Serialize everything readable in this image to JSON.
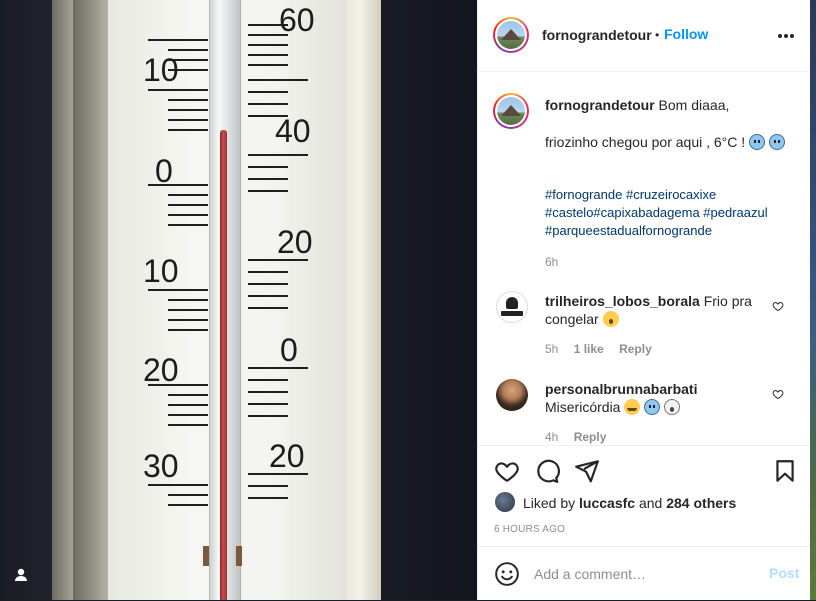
{
  "photo": {
    "alt_subject": "thermometer",
    "scale_left": [
      "10",
      "0",
      "10",
      "20",
      "30"
    ],
    "scale_right": [
      "60",
      "40",
      "20",
      "0",
      "20"
    ]
  },
  "header": {
    "username": "fornograndetour",
    "separator": "•",
    "follow_label": "Follow"
  },
  "caption": {
    "username": "fornograndetour",
    "line1": "Bom diaaa,",
    "line2": "friozinho chegou por aqui , 6°C !",
    "hashtags": [
      "#fornogrande",
      "#cruzeirocaxixe",
      "#castelo",
      "#capixabadagema",
      "#pedraazul",
      "#parqueestadualfornogrande"
    ],
    "time": "6h"
  },
  "comments": [
    {
      "username": "trilheiros_lobos_borala",
      "text": "Frio pra congelar",
      "time": "5h",
      "likes": "1 like",
      "reply": "Reply"
    },
    {
      "username": "personalbrunnabarbati",
      "text": "Misericórdia",
      "time": "4h",
      "reply": "Reply"
    }
  ],
  "likes": {
    "prefix": "Liked by",
    "user": "luccasfc",
    "and": "and",
    "others": "284 others"
  },
  "time_ago": "6 HOURS AGO",
  "add_comment": {
    "placeholder": "Add a comment…",
    "post_label": "Post"
  },
  "colors": {
    "accent": "#0095f6",
    "hashtag": "#00376b",
    "muted": "#8e8e8e",
    "post_disabled": "#b2dffc"
  }
}
